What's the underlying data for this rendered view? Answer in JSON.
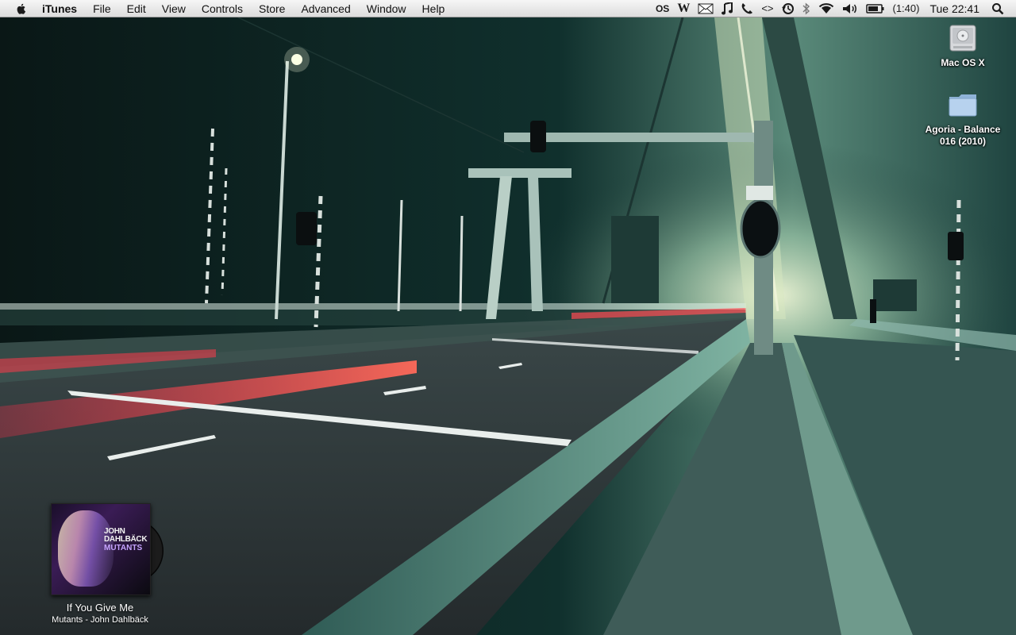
{
  "menubar": {
    "app_name": "iTunes",
    "items": [
      "File",
      "Edit",
      "View",
      "Controls",
      "Store",
      "Advanced",
      "Window",
      "Help"
    ],
    "status": {
      "os_badge": "OS",
      "w_badge": "W",
      "battery_time": "(1:40)",
      "clock": "Tue 22:41"
    },
    "icons": [
      "apple-icon",
      "os-icon",
      "w-icon",
      "mail-icon",
      "music-note-icon",
      "phone-icon",
      "sync-arrows-icon",
      "time-machine-icon",
      "bluetooth-icon",
      "wifi-icon",
      "volume-icon",
      "battery-icon",
      "spotlight-icon"
    ]
  },
  "desktop": {
    "icons": [
      {
        "label": "Mac OS X",
        "icon": "hard-drive-icon"
      },
      {
        "label": "Agoria - Balance 016 (2010)",
        "icon": "folder-icon"
      }
    ]
  },
  "now_playing": {
    "album_art_title": "JOHN DAHLBÄCK",
    "album_art_subtitle": "MUTANTS",
    "track": "If You Give Me",
    "subtitle": "Mutants - John Dahlbäck"
  },
  "colors": {
    "sky": "#0f2826",
    "road": "#2e3536",
    "bridge_glow": "#e8f0c8",
    "light_trail": "#ff3a4a"
  }
}
